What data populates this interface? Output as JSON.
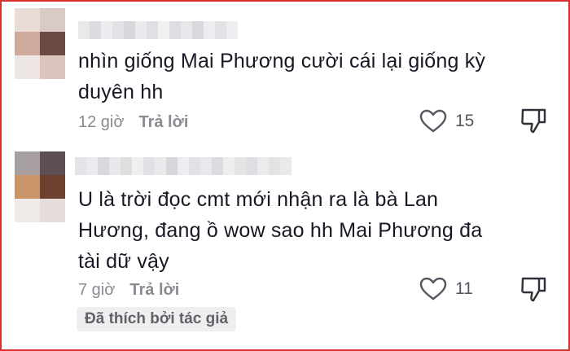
{
  "comments": [
    {
      "text_line1": "nhìn giống Mai Phương cười cái lại giống kỳ",
      "text_line2": "duyên hh",
      "time": "12 giờ",
      "reply_label": "Trả lời",
      "like_count": "15"
    },
    {
      "text_line1": "U là trời đọc cmt mới nhận ra là bà Lan",
      "text_line2": "Hương, đang ồ wow sao hh Mai Phương đa",
      "text_line3": "tài dữ vậy",
      "time": "7 giờ",
      "reply_label": "Trả lời",
      "like_count": "11",
      "liked_by_author_badge": "Đã thích bởi tác giả"
    }
  ],
  "icons": {
    "like": "heart-outline-icon",
    "dislike": "thumbs-down-icon"
  },
  "colors": {
    "frame_border": "#d8322c",
    "muted_text": "#8a8b91",
    "badge_bg": "#efeff0"
  }
}
